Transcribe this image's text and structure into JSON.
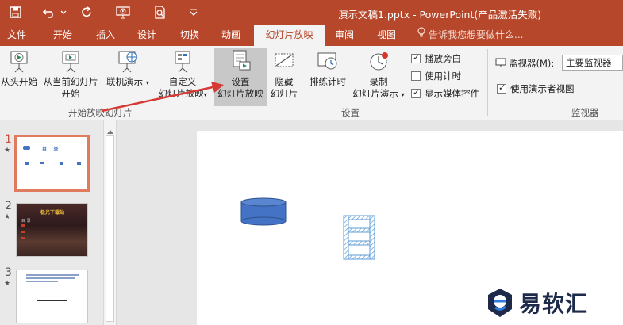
{
  "titlebar": {
    "title": "演示文稿1.pptx - PowerPoint(产品激活失败)"
  },
  "tabs": [
    {
      "label": "文件"
    },
    {
      "label": "开始"
    },
    {
      "label": "插入"
    },
    {
      "label": "设计"
    },
    {
      "label": "切换"
    },
    {
      "label": "动画"
    },
    {
      "label": "幻灯片放映"
    },
    {
      "label": "审阅"
    },
    {
      "label": "视图"
    }
  ],
  "search_placeholder": "告诉我您想要做什么...",
  "ribbon": {
    "start_group": {
      "label": "开始放映幻灯片",
      "from_beginning": "从头开始",
      "from_current_line1": "从当前幻灯片",
      "from_current_line2": "开始",
      "online_present": "联机演示",
      "custom_line1": "自定义",
      "custom_line2": "幻灯片放映"
    },
    "setup_group": {
      "label": "设置",
      "setup_line1": "设置",
      "setup_line2": "幻灯片放映",
      "hide_line1": "隐藏",
      "hide_line2": "幻灯片",
      "rehearse": "排练计时",
      "record_line1": "录制",
      "record_line2": "幻灯片演示",
      "play_narrations": "播放旁白",
      "use_timings": "使用计时",
      "show_media_controls": "显示媒体控件"
    },
    "monitor_group": {
      "label": "监视器",
      "monitor_label": "监视器(M):",
      "monitor_value": "主要监视器",
      "presenter_view": "使用演示者视图"
    }
  },
  "checkbox_states": {
    "play_narrations": true,
    "use_timings": false,
    "show_media_controls": true,
    "presenter_view": true
  },
  "slides": [
    {
      "number": "1",
      "star": "★",
      "title_text": "目    录"
    },
    {
      "number": "2",
      "star": "★",
      "banner_text": "极光下载站",
      "menu_text": "目 录"
    },
    {
      "number": "3",
      "star": "★"
    }
  ],
  "watermark": {
    "text": "易软汇"
  },
  "colors": {
    "accent": "#b7472a",
    "highlight": "#c8c8c8",
    "selection_border": "#e07b5f",
    "shape_fill": "#4472c4",
    "arrow": "#d63a35"
  }
}
